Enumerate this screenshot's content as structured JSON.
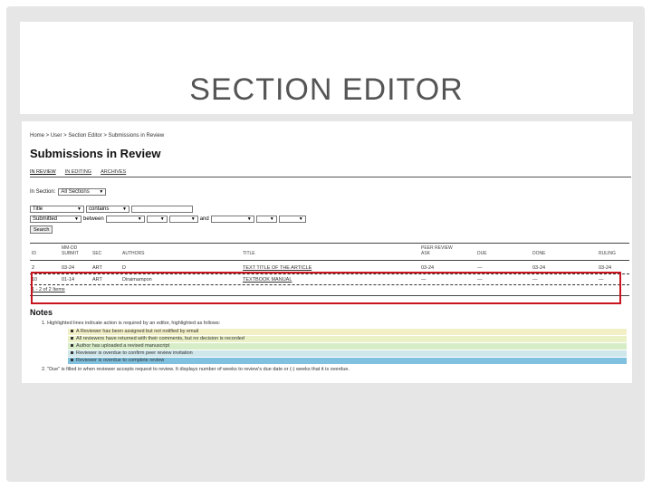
{
  "slide": {
    "title": "SECTION EDITOR"
  },
  "screen": {
    "breadcrumb": "Home > User > Section Editor > Submissions in Review",
    "heading": "Submissions in Review",
    "tabs": [
      {
        "label": "IN REVIEW",
        "active": true
      },
      {
        "label": "IN EDITING",
        "active": false
      },
      {
        "label": "ARCHIVES",
        "active": false
      }
    ],
    "section_filter": {
      "label": "In Section:",
      "value": "All Sections"
    },
    "search": {
      "field": "Title",
      "match": "contains",
      "date_field": "Submitted",
      "between_label": "between",
      "and_label": "and",
      "button": "Search"
    },
    "table": {
      "columns": [
        "ID",
        "MM-DD SUBMIT",
        "SEC",
        "AUTHORS",
        "TITLE",
        "PEER REVIEW ASK",
        "DUE",
        "DONE",
        "RULING"
      ],
      "rows": [
        [
          "2",
          "03-24",
          "ART",
          "D",
          "TEXT TITLE OF THE ARTICLE",
          "03-24",
          "—",
          "03-24",
          "03-24"
        ],
        [
          "10",
          "01-14",
          "ART",
          "Diraimampon",
          "TEXTBOOK MANUAL",
          "—",
          "—",
          "—",
          "—"
        ]
      ],
      "count": "1 - 2 of 2 Items"
    },
    "notes": {
      "heading": "Notes",
      "item1": "1. Highlighted lines indicate action is required by an editor, highlighted as follows:",
      "legend": [
        {
          "text": "A Reviewer has been assigned but not notified by email",
          "color": "#f3efc6"
        },
        {
          "text": "All reviewers have returned with their comments, but no decision is recorded",
          "color": "#eaf1c6"
        },
        {
          "text": "Author has uploaded a revised manuscript",
          "color": "#d7edc8"
        },
        {
          "text": "Reviewer is overdue to confirm peer review invitation",
          "color": "#cfe6ea"
        },
        {
          "text": "Reviewer is overdue to complete review",
          "color": "#7fc1de"
        }
      ],
      "item2": "2. \"Due\" is filled in when reviewer accepts request to review. It displays number of weeks to review's due date or (-) weeks that it is overdue."
    }
  }
}
